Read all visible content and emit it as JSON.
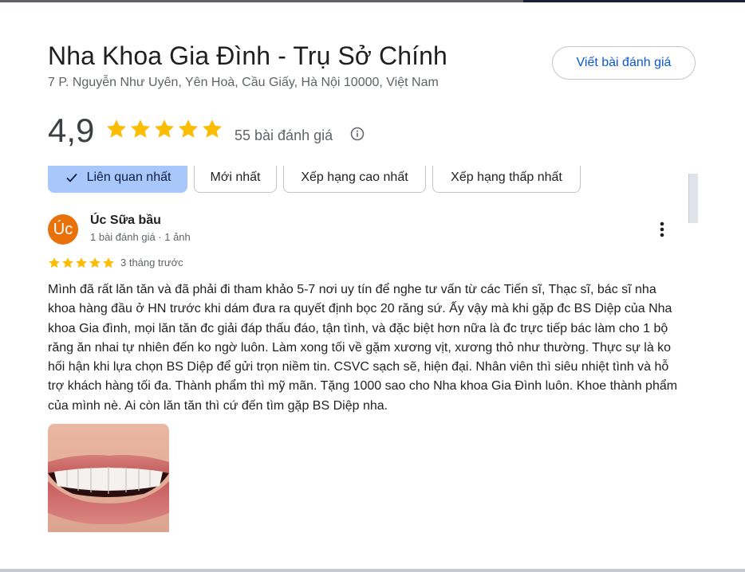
{
  "place": {
    "title": "Nha Khoa Gia Đình - Trụ Sở Chính",
    "address": "7 P. Nguyễn Như Uyên, Yên Hoà, Cầu Giấy, Hà Nội 10000, Việt Nam",
    "write_review_label": "Viết bài đánh giá",
    "rating": "4,9",
    "stars": 5,
    "review_count_label": "55 bài đánh giá"
  },
  "sort_chips": [
    {
      "label": "Liên quan nhất",
      "active": true
    },
    {
      "label": "Mới nhất",
      "active": false
    },
    {
      "label": "Xếp hạng cao nhất",
      "active": false
    },
    {
      "label": "Xếp hạng thấp nhất",
      "active": false
    }
  ],
  "review": {
    "avatar_text": "Úc",
    "avatar_color": "#e8710a",
    "author": "Úc Sữa bầu",
    "meta": "1 bài đánh giá · 1 ảnh",
    "stars": 5,
    "time": "3 tháng trước",
    "text": "Mình đã rất lăn tăn và đã phải đi tham khảo 5-7 nơi uy tín để nghe tư vấn từ các Tiến sĩ, Thạc sĩ, bác sĩ nha khoa hàng đầu ở HN trước khi dám đưa ra quyết định bọc 20 răng sứ. Ấy vậy mà khi gặp đc BS Diệp của Nha khoa Gia đình, mọi lăn tăn đc giải đáp thấu đáo, tận tình, và đặc biệt hơn nữa là đc trực tiếp bác làm cho 1 bộ răng ăn nhai tự nhiên đến ko ngờ luôn. Làm xong tối về gặm xương vịt, xương thỏ như thường. Thực sự là ko hối hận khi lựa chọn BS Diệp để gửi trọn niềm tin. CSVC sạch sẽ, hiện đại. Nhân viên thì siêu nhiệt tình và hỗ trợ khách hàng tối đa. Thành phẩm thì mỹ mãn. Tặng 1000 sao cho Nha khoa Gia Đình luôn. Khoe thành phẩm của mình nè. Ai còn lăn tăn thì cứ đến tìm gặp BS Diệp nha."
  },
  "colors": {
    "accent": "#0b57d0",
    "star": "#fbbc04",
    "chip_active": "#a8c7fa"
  }
}
